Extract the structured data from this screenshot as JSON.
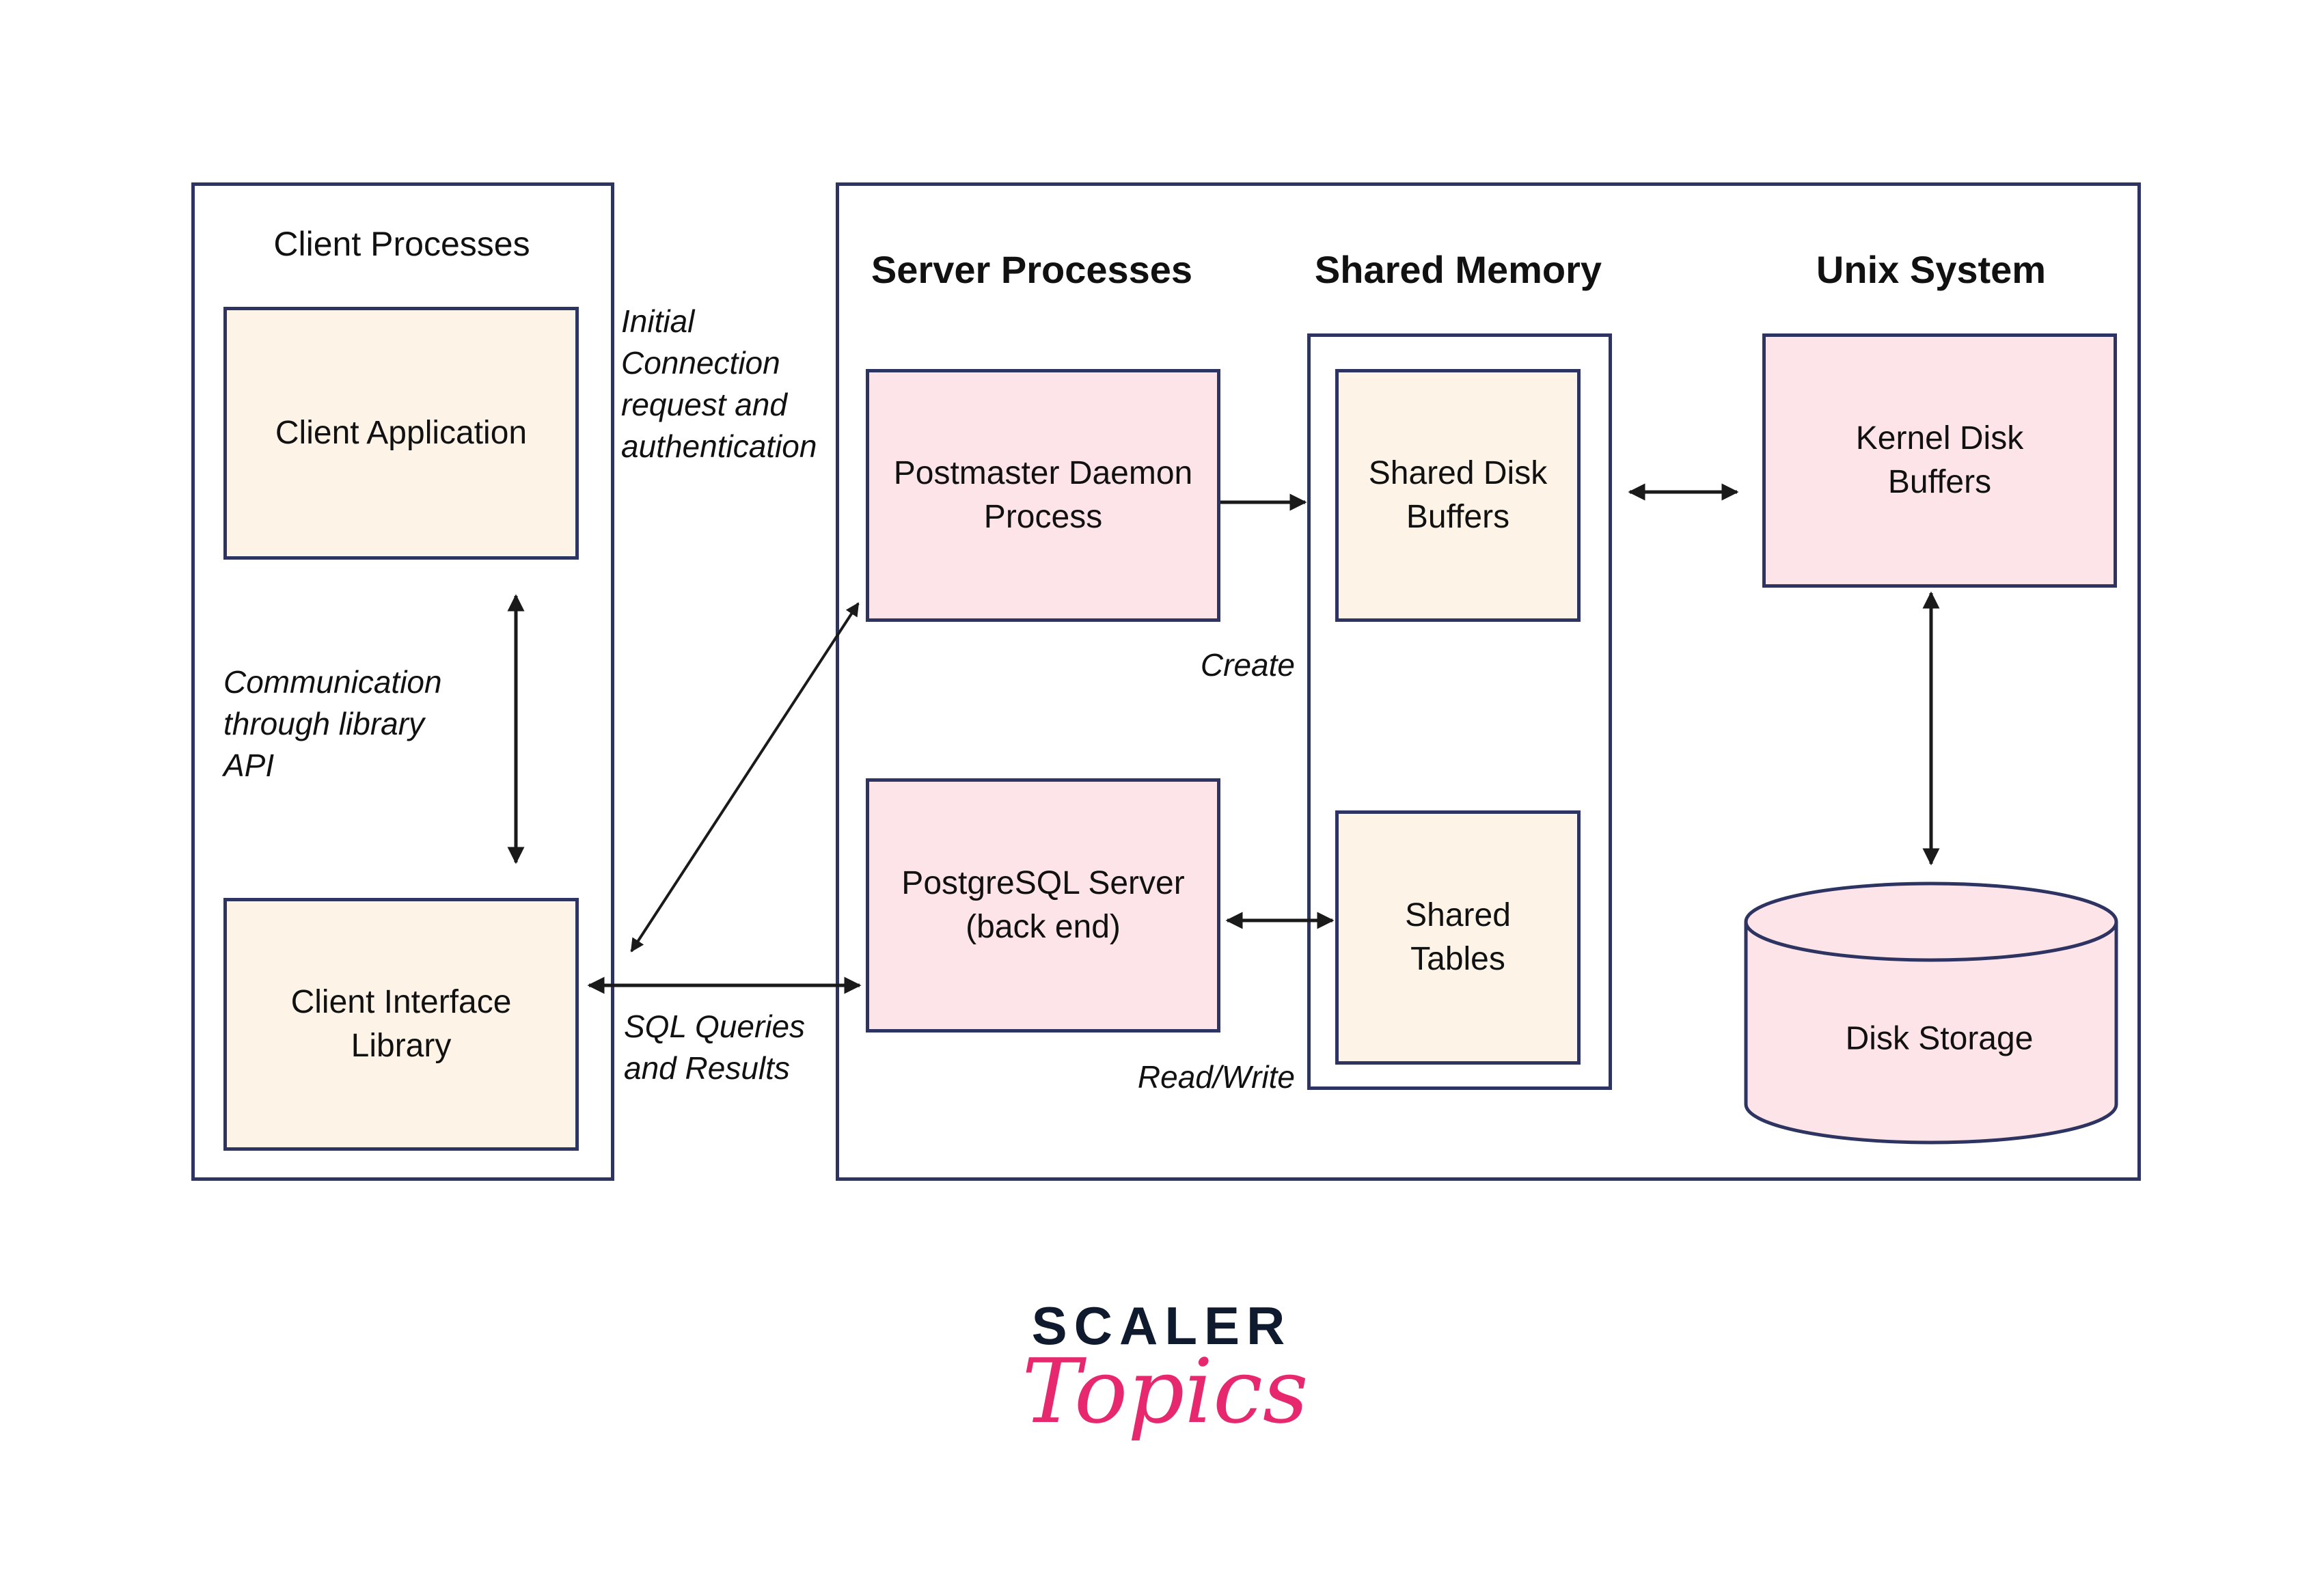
{
  "diagram": {
    "client_group": {
      "title": "Client Processes",
      "client_application": "Client Application",
      "client_interface_library": "Client Interface Library",
      "api_note": "Communication\nthrough library\nAPI"
    },
    "connection_note": "Initial\nConnection\nrequest and\nauthentication",
    "sql_note": "SQL Queries\nand Results",
    "server_group": {
      "server_processes_title": "Server Processes",
      "shared_memory_title": "Shared Memory",
      "unix_system_title": "Unix System",
      "postmaster": "Postmaster Daemon Process",
      "postgres_server": "PostgreSQL Server (back end)",
      "shared_disk_buffers": "Shared Disk Buffers",
      "shared_tables": "Shared Tables",
      "kernel_disk_buffers": "Kernel Disk Buffers",
      "disk_storage": "Disk Storage",
      "create_note": "Create",
      "read_write_note": "Read/Write"
    },
    "edges": [
      {
        "from": "Client Application",
        "to": "Client Interface Library",
        "type": "bidirectional"
      },
      {
        "from": "Client Interface Library",
        "to": "Postmaster Daemon Process",
        "type": "bidirectional",
        "label": "Initial Connection request and authentication"
      },
      {
        "from": "Client Interface Library",
        "to": "PostgreSQL Server (back end)",
        "type": "bidirectional",
        "label": "SQL Queries and Results"
      },
      {
        "from": "Postmaster Daemon Process",
        "to": "Shared Memory",
        "type": "directed",
        "label": "Create"
      },
      {
        "from": "PostgreSQL Server (back end)",
        "to": "Shared Tables",
        "type": "bidirectional",
        "label": "Read/Write"
      },
      {
        "from": "Shared Disk Buffers",
        "to": "Kernel Disk Buffers",
        "type": "bidirectional"
      },
      {
        "from": "Kernel Disk Buffers",
        "to": "Disk Storage",
        "type": "bidirectional"
      }
    ],
    "colors": {
      "border": "#2e3461",
      "client_fill": "#fdf4e7",
      "server_fill": "#fde4e9",
      "arrow": "#1a1a1a"
    }
  },
  "logo": {
    "top": "SCALER",
    "bottom": "Topics",
    "top_color": "#0f1a2e",
    "bottom_color": "#e7286f"
  }
}
